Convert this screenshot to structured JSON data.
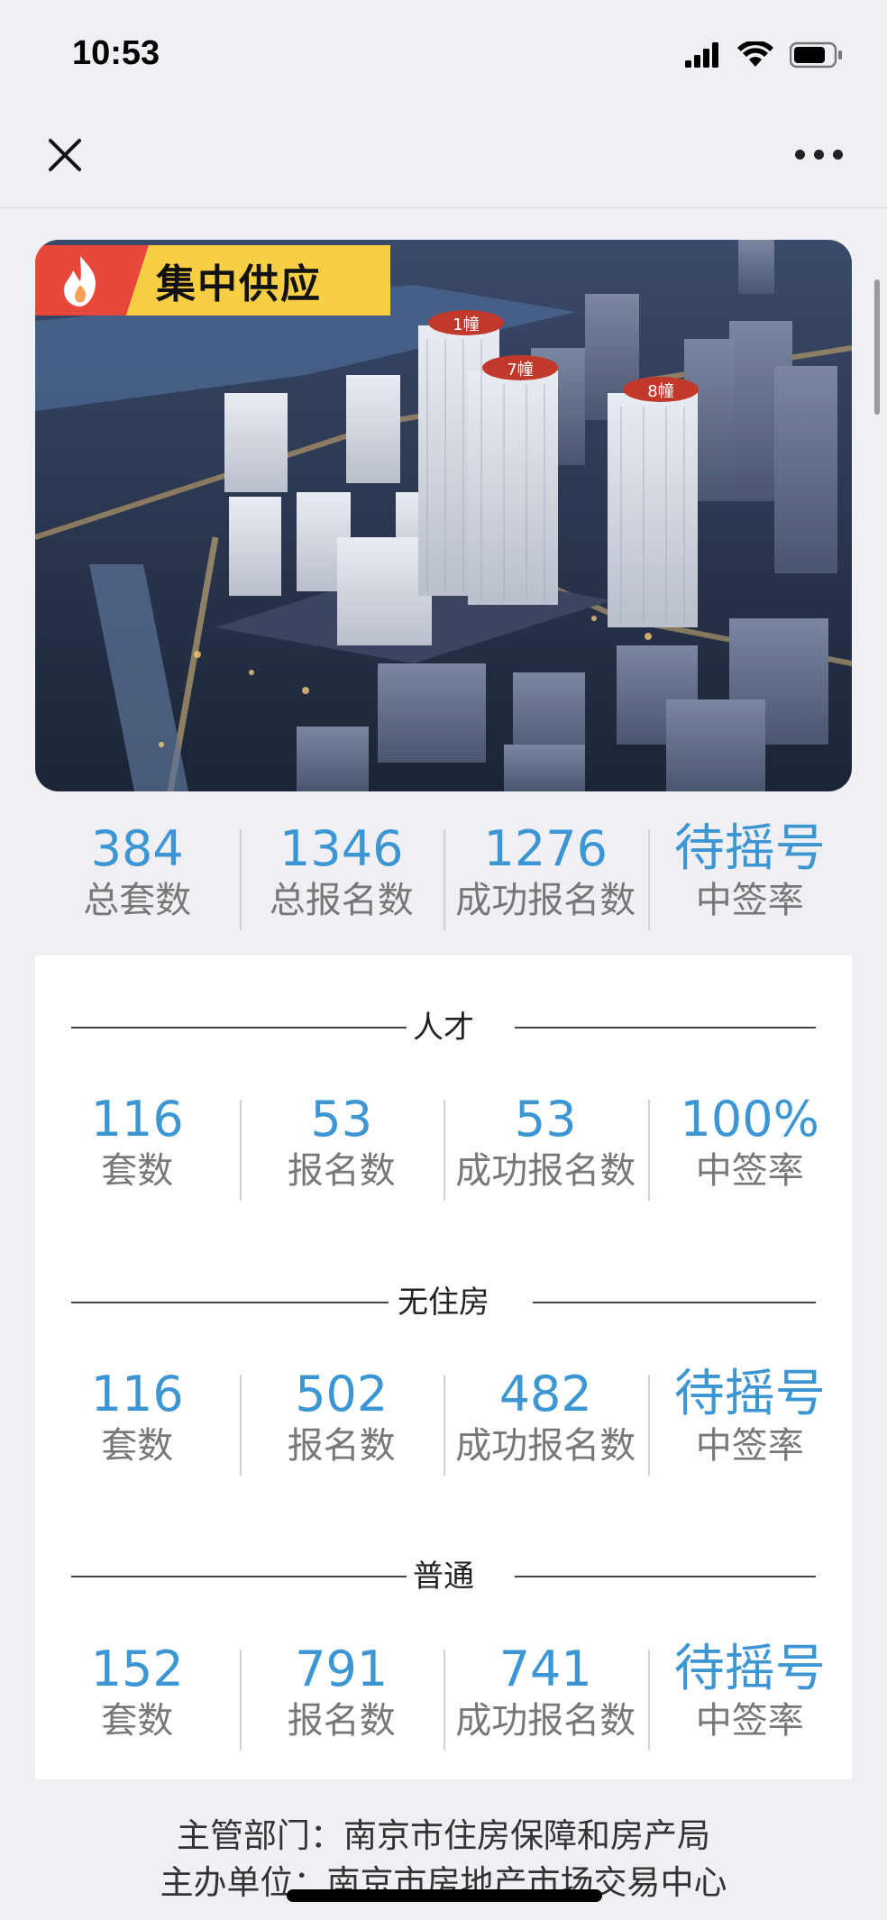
{
  "status": {
    "time": "10:53"
  },
  "hero": {
    "banner_label": "集中供应",
    "buildings": [
      "1幢",
      "7幢",
      "8幢"
    ]
  },
  "summary": [
    {
      "value": "384",
      "label": "总套数"
    },
    {
      "value": "1346",
      "label": "总报名数"
    },
    {
      "value": "1276",
      "label": "成功报名数"
    },
    {
      "value": "待摇号",
      "label": "中签率"
    }
  ],
  "sections": [
    {
      "title": "人才",
      "stats": [
        {
          "value": "116",
          "label": "套数"
        },
        {
          "value": "53",
          "label": "报名数"
        },
        {
          "value": "53",
          "label": "成功报名数"
        },
        {
          "value": "100%",
          "label": "中签率"
        }
      ]
    },
    {
      "title": "无住房",
      "stats": [
        {
          "value": "116",
          "label": "套数"
        },
        {
          "value": "502",
          "label": "报名数"
        },
        {
          "value": "482",
          "label": "成功报名数"
        },
        {
          "value": "待摇号",
          "label": "中签率"
        }
      ]
    },
    {
      "title": "普通",
      "stats": [
        {
          "value": "152",
          "label": "套数"
        },
        {
          "value": "791",
          "label": "报名数"
        },
        {
          "value": "741",
          "label": "成功报名数"
        },
        {
          "value": "待摇号",
          "label": "中签率"
        }
      ]
    }
  ],
  "footer": {
    "dept_label": "主管部门：",
    "dept_value": "南京市住房保障和房产局",
    "org_label": "主办单位：",
    "org_value": "南京市房地产市场交易中心"
  },
  "colors": {
    "accent": "#3d96d4",
    "banner": "#f8cf44",
    "flame_bg": "#e8483c"
  }
}
